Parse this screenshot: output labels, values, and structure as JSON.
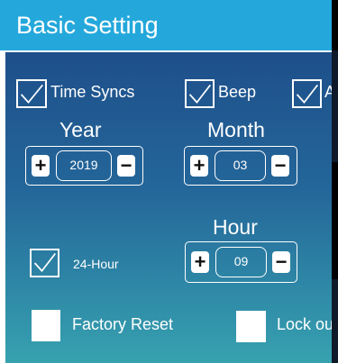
{
  "header": {
    "title": "Basic Setting"
  },
  "checks": {
    "time_syncs": "Time Syncs",
    "beep": "Beep",
    "third_partial": "A",
    "hour24": "24-Hour",
    "factory_reset": "Factory Reset",
    "lock_out_partial": "Lock ou"
  },
  "fields": {
    "year": {
      "label": "Year",
      "value": "2019",
      "minus": "−",
      "plus": "+"
    },
    "month": {
      "label": "Month",
      "value": "03",
      "minus": "−",
      "plus": "+"
    },
    "hour": {
      "label": "Hour",
      "value": "09",
      "minus": "−",
      "plus": "+"
    }
  },
  "colors": {
    "header": "#24a8db",
    "panel_top": "#1e4f8a",
    "panel_bottom": "#37a2b0"
  }
}
